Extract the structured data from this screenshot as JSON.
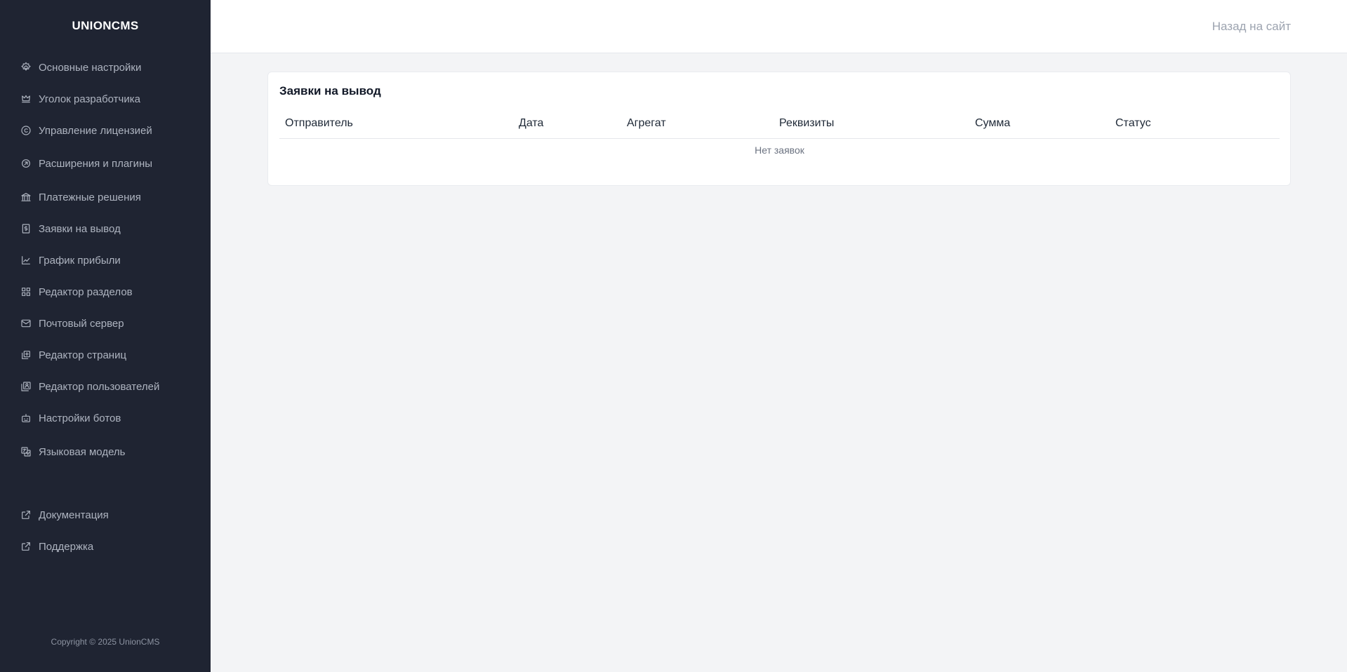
{
  "sidebar": {
    "brand": "UNIONCMS",
    "items": [
      {
        "label": "Основные настройки",
        "icon": "gear-icon"
      },
      {
        "label": "Уголок разработчика",
        "icon": "crown-icon"
      },
      {
        "label": "Управление лицензией",
        "icon": "copyright-icon"
      },
      {
        "label": "Расширения и плагины",
        "icon": "plugin-icon"
      },
      {
        "label": "Платежные решения",
        "icon": "bank-icon"
      },
      {
        "label": "Заявки на вывод",
        "icon": "dollar-file-icon"
      },
      {
        "label": "График прибыли",
        "icon": "line-chart-icon"
      },
      {
        "label": "Редактор разделов",
        "icon": "grid-icon"
      },
      {
        "label": "Почтовый сервер",
        "icon": "mail-icon"
      },
      {
        "label": "Редактор страниц",
        "icon": "page-plus-icon"
      },
      {
        "label": "Редактор пользователей",
        "icon": "user-card-icon"
      },
      {
        "label": "Настройки ботов",
        "icon": "robot-icon"
      },
      {
        "label": "Языковая модель",
        "icon": "translate-icon"
      }
    ],
    "links": [
      {
        "label": "Документация",
        "icon": "external-link-icon"
      },
      {
        "label": "Поддержка",
        "icon": "external-link-icon"
      }
    ],
    "copyright": "Copyright © 2025 UnionCMS"
  },
  "topbar": {
    "back_link": "Назад на сайт"
  },
  "main": {
    "title": "Заявки на вывод",
    "columns": [
      "Отправитель",
      "Дата",
      "Агрегат",
      "Реквизиты",
      "Сумма",
      "Статус"
    ],
    "empty_text": "Нет заявок"
  },
  "colors": {
    "sidebar_bg": "#1f2432",
    "page_bg": "#f3f4f6",
    "card_bg": "#ffffff"
  }
}
